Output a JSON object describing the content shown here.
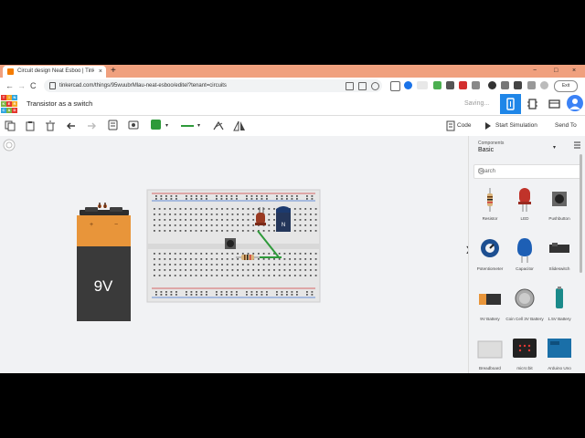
{
  "browser": {
    "tab_title": "Circuit design Neat Esboo | Tinkercad",
    "tab_close": "×",
    "new_tab": "+",
    "url": "tinkercad.com/things/95wuubrMlau-neat-esboo/editel?tenant=circuits",
    "back": "←",
    "forward": "→",
    "reload": "C",
    "win_min": "−",
    "win_max": "□",
    "win_close": "×",
    "exit_label": "Exit"
  },
  "header": {
    "logo_letters": [
      "TIN",
      "KER",
      "CAD"
    ],
    "title": "Transistor as a switch",
    "status": "Saving..."
  },
  "toolbar": {
    "code_label": "Code",
    "simulate_label": "Start Simulation",
    "send_label": "Send To"
  },
  "canvas": {
    "battery_label": "9V",
    "battery_plus": "+",
    "battery_minus": "−",
    "transistor_label": "N"
  },
  "panel": {
    "components_title": "Components",
    "selected": "Basic",
    "search_placeholder": "Search",
    "collapse_icon": "❯",
    "components": [
      {
        "label": "Resistor",
        "icon": "resistor-icon"
      },
      {
        "label": "LED",
        "icon": "led-icon"
      },
      {
        "label": "Pushbutton",
        "icon": "pushbutton-icon"
      },
      {
        "label": "Potentiometer",
        "icon": "potentiometer-icon"
      },
      {
        "label": "Capacitor",
        "icon": "capacitor-icon"
      },
      {
        "label": "Slideswitch",
        "icon": "slideswitch-icon"
      },
      {
        "label": "9V Battery",
        "icon": "9v-battery-icon"
      },
      {
        "label": "Coin Cell 3V Battery",
        "icon": "coin-cell-icon"
      },
      {
        "label": "1.5V Battery",
        "icon": "aa-battery-icon"
      },
      {
        "label": "Breadboard",
        "icon": "breadboard-icon"
      },
      {
        "label": "micro:bit",
        "icon": "microbit-icon"
      },
      {
        "label": "Arduino Uno",
        "icon": "arduino-icon"
      }
    ]
  },
  "colors": {
    "tab_strip": "#f0a07e",
    "accent_blue": "#1f86e8",
    "workplane": "#f1f2f4",
    "battery_orange": "#e8953a",
    "battery_body": "#3a3a3a",
    "wire_green": "#2e9a3a"
  }
}
